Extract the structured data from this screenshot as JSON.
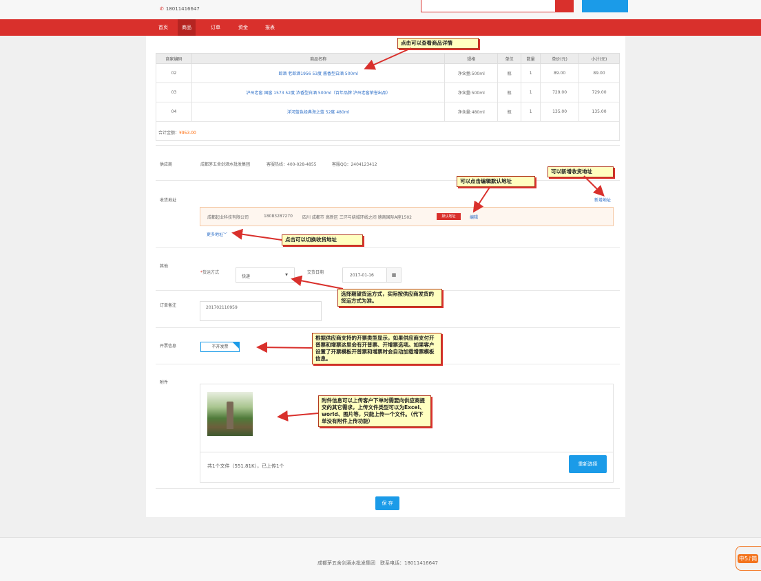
{
  "header": {
    "phone": "18011416647"
  },
  "nav": {
    "items": [
      "首页",
      "商品",
      "订单",
      "资金",
      "报表"
    ]
  },
  "table": {
    "headers": [
      "商家编码",
      "商品名称",
      "规格",
      "单位",
      "数量",
      "单价(元)",
      "小计(元)"
    ],
    "rows": [
      {
        "code": "02",
        "name": "郎酒 老郎酒1956 53度 酱香型白酒 500ml",
        "spec": "净含量:500ml",
        "unit": "瓶",
        "qty": "1",
        "price": "89.00",
        "subtotal": "89.00"
      },
      {
        "code": "03",
        "name": "泸州老窖 国窖 1573 52度 浓香型白酒 500ml（百年品牌 泸州老窖荣誉出品）",
        "spec": "净含量:500ml",
        "unit": "瓶",
        "qty": "1",
        "price": "729.00",
        "subtotal": "729.00"
      },
      {
        "code": "04",
        "name": "洋河蓝色经典海之蓝 52度 480ml",
        "spec": "净含量:480ml",
        "unit": "瓶",
        "qty": "1",
        "price": "135.00",
        "subtotal": "135.00"
      }
    ],
    "total_label": "合计金额：",
    "total_value": "¥953.00"
  },
  "supplier": {
    "label": "供应商",
    "name": "成都茅五舍剑酒水批发集团",
    "hotline": "客服热线：400-028-4855",
    "qq": "客服QQ：2404123412"
  },
  "address": {
    "label": "收货地址",
    "add_link": "新增地址",
    "company": "成都起业科技有限公司",
    "phone": "18083287270",
    "detail": "四川 成都市 高新区 三环与绕城环线之间 德商国际A座1502",
    "default_badge": "默认地址",
    "edit_link": "编辑",
    "more_link": "更多地址"
  },
  "other": {
    "label": "其他",
    "shipping_label": "货运方式",
    "shipping_value": "快递",
    "date_label": "交货日期",
    "date_value": "2017-01-16"
  },
  "remark": {
    "label": "订单备注",
    "value": "201702110959"
  },
  "invoice": {
    "label": "开票信息",
    "value": "不开发票"
  },
  "attachment": {
    "label": "附件",
    "file_info": "共1个文件（551.81K），已上传1个",
    "reselect_button": "重新选择"
  },
  "save_button": "保 存",
  "footer": {
    "text": "成都茅五舍剑酒水批发集团　联系电话：18011416647"
  },
  "float_widget": {
    "text": "中5♪简"
  },
  "callouts": {
    "detail": "点击可以查看商品详情",
    "edit_default": "可以点击编辑默认地址",
    "add_address": "可以新增收货地址",
    "switch_address": "点击可以切换收货地址",
    "shipping": "选择期望货运方式，实际按供应商发货的货运方式为准。",
    "invoice": "根据供应商支持的开票类型显示，如果供应商支付开普票和增票这里会有开普票、开增票选项。如果客户设置了开票模板开普票和增票时会自动加载增票模板信息。",
    "attachment": "附件信息可以上传客户下单时需要向供应商提交的其它需求，上传文件类型可以为Excel、world、图片等，只能上传一个文件。（代下单没有附件上传功能）"
  }
}
